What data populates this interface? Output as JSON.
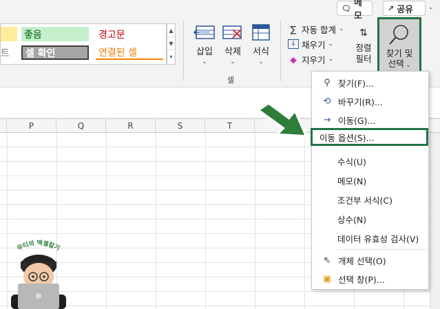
{
  "header": {
    "memo_label": "메모",
    "share_label": "공유"
  },
  "styles_gallery": {
    "good": "좋음",
    "warning": "경고문",
    "check_cell": "셀 확인",
    "linked_cell": "연결된 셀",
    "partial_left": "트"
  },
  "cells_group": {
    "insert": "삽입",
    "delete": "삭제",
    "format": "서식",
    "group_label": "셀"
  },
  "editing_group": {
    "autosum": "자동 합계",
    "fill": "채우기",
    "clear": "지우기",
    "sort_line1": "정렬",
    "sort_line2": "필터",
    "find_line1": "찾기 및",
    "find_line2": "선택"
  },
  "columns": [
    "P",
    "Q",
    "R",
    "S",
    "T"
  ],
  "menu": {
    "find": "찾기(F)...",
    "replace": "바꾸기(R)...",
    "goto": "이동(G)...",
    "goto_special": "이동 옵션(S)...",
    "formulas": "수식(U)",
    "comments": "메모(N)",
    "conditional": "조건부 서식(C)",
    "constants": "상수(N)",
    "validation": "데이터 유효성 검사(V)",
    "select_objects": "개체 선택(O)",
    "selection_pane": "선택 창(P)..."
  },
  "avatar": {
    "caption": "무티의 엑셀칼기"
  },
  "colors": {
    "accent_green": "#217346",
    "arrow_green": "#2e7d3a"
  }
}
